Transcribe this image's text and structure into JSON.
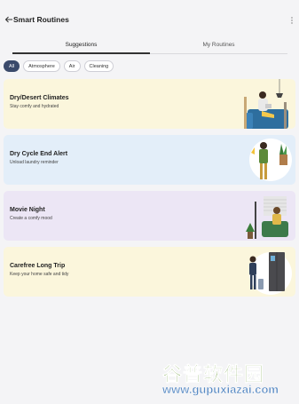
{
  "header": {
    "title": "Smart Routines"
  },
  "tabs": [
    {
      "label": "Suggestions"
    },
    {
      "label": "My Routines"
    }
  ],
  "filters": [
    {
      "label": "All"
    },
    {
      "label": "Atmosphere"
    },
    {
      "label": "Air"
    },
    {
      "label": "Cleaning"
    }
  ],
  "routines": [
    {
      "name": "Dry/Desert Climates",
      "description": "Stay comfy and hydrated",
      "color": "#fbf6dc"
    },
    {
      "name": "Dry Cycle End Alert",
      "description": "Unload laundry reminder",
      "color": "#e3eef9"
    },
    {
      "name": "Movie Night",
      "description": "Create a comfy mood",
      "color": "#ece6f5"
    },
    {
      "name": "Carefree Long Trip",
      "description": "Keep your home safe and tidy",
      "color": "#fbf6dc"
    }
  ],
  "watermark": {
    "text": "谷普软件园",
    "url": "www.gupuxiazai.com"
  },
  "colors": {
    "active_chip": "#3a4a6b",
    "background": "#f4f4f6"
  }
}
